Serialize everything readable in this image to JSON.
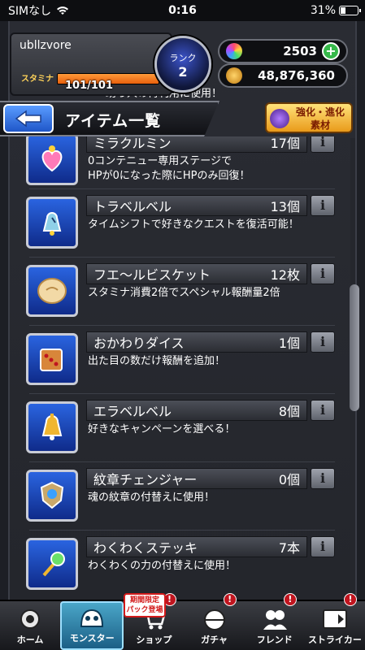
{
  "status_bar": {
    "carrier": "SIMなし",
    "time": "0:16",
    "battery": "31%"
  },
  "player": {
    "name": "ubllzvore",
    "stamina_label": "スタミナ",
    "stamina_value": "101/101",
    "stamina_fraction": 1.0
  },
  "rank": {
    "label": "ランク",
    "value": "2"
  },
  "currency": {
    "orbs": "2503",
    "gold": "48,876,360"
  },
  "title": "アイテム一覧",
  "enhance_button": {
    "line1": "強化・進化",
    "line2": "素材"
  },
  "items": [
    {
      "name": "ミラクルミン",
      "count": "17個",
      "desc": "0コンテニュー専用ステージで\nHPが0になった際にHPのみ回復！",
      "icon": "miraclemin-icon"
    },
    {
      "name": "トラベルベル",
      "count": "13個",
      "desc": "タイムシフトで好きなクエストを復活可能！",
      "icon": "travel-bell-icon"
    },
    {
      "name": "フエ～ルビスケット",
      "count": "12枚",
      "desc": "スタミナ消費2倍でスペシャル報酬量2倍",
      "icon": "biscuit-icon"
    },
    {
      "name": "おかわりダイス",
      "count": "1個",
      "desc": "出た目の数だけ報酬を追加！",
      "icon": "dice-icon"
    },
    {
      "name": "エラベルベル",
      "count": "8個",
      "desc": "好きなキャンペーンを選べる！",
      "icon": "erabel-bell-icon"
    },
    {
      "name": "紋章チェンジャー",
      "count": "0個",
      "desc": "魂の紋章の付替えに使用！",
      "icon": "emblem-changer-icon"
    },
    {
      "name": "わくわくステッキ",
      "count": "7本",
      "desc": "わくわくの力の付替えに使用！",
      "icon": "waku-stick-icon"
    }
  ],
  "info_label": "i",
  "partial_top_text": "助っ人の再利用に使用！",
  "nav": {
    "items": [
      {
        "label": "ホーム",
        "icon": "home-icon"
      },
      {
        "label": "モンスター",
        "icon": "monster-icon"
      },
      {
        "label": "ショップ",
        "icon": "shop-icon"
      },
      {
        "label": "ガチャ",
        "icon": "gacha-icon"
      },
      {
        "label": "フレンド",
        "icon": "friend-icon"
      },
      {
        "label": "ストライカー",
        "icon": "striker-icon"
      }
    ],
    "promo_line1": "期間限定",
    "promo_line2": "パック登場",
    "badge": "!"
  },
  "colors": {
    "accent_blue": "#2a64e0",
    "stamina_orange": "#e8600c",
    "badge_red": "#c0151f"
  }
}
